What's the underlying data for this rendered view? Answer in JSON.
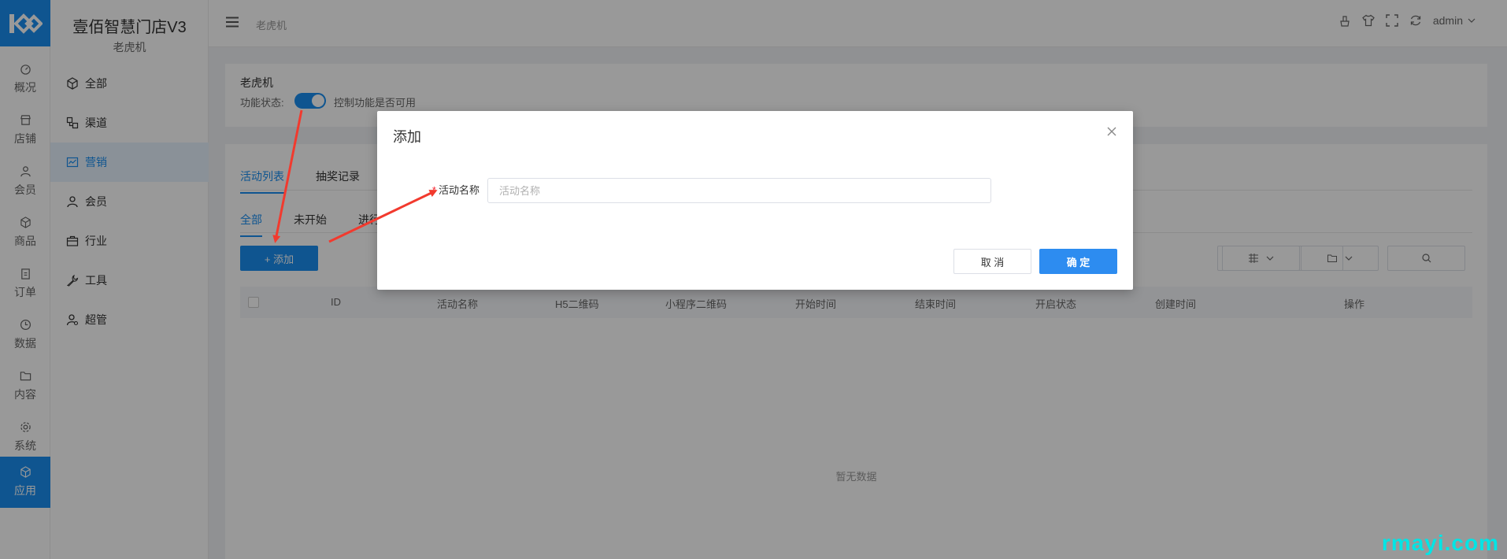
{
  "rail": {
    "items": [
      {
        "label": "概况",
        "icon": "dashboard-icon"
      },
      {
        "label": "店铺",
        "icon": "shop-icon"
      },
      {
        "label": "会员",
        "icon": "user-icon"
      },
      {
        "label": "商品",
        "icon": "cube-icon"
      },
      {
        "label": "订单",
        "icon": "clipboard-icon"
      },
      {
        "label": "数据",
        "icon": "clock-icon"
      },
      {
        "label": "内容",
        "icon": "folder-icon"
      },
      {
        "label": "系统",
        "icon": "gear-icon"
      },
      {
        "label": "应用",
        "icon": "app-icon",
        "active": true
      }
    ]
  },
  "sidebar": {
    "brand": "壹佰智慧门店V3",
    "subtitle": "老虎机",
    "items": [
      {
        "label": "全部",
        "icon": "cube-icon"
      },
      {
        "label": "渠道",
        "icon": "channel-icon"
      },
      {
        "label": "营销",
        "icon": "chart-icon",
        "active": true
      },
      {
        "label": "会员",
        "icon": "user-icon"
      },
      {
        "label": "行业",
        "icon": "briefcase-icon"
      },
      {
        "label": "工具",
        "icon": "wrench-icon"
      },
      {
        "label": "超管",
        "icon": "admin-icon"
      }
    ]
  },
  "header": {
    "breadcrumb": "老虎机",
    "user": "admin"
  },
  "feature": {
    "title": "老虎机",
    "status_label": "功能状态:",
    "status_hint": "控制功能是否可用",
    "enabled": true
  },
  "tabs": [
    "活动列表",
    "抽奖记录"
  ],
  "filter_tabs": [
    "全部",
    "未开始",
    "进行"
  ],
  "add_button": "+ 添加",
  "table": {
    "columns": [
      "ID",
      "活动名称",
      "H5二维码",
      "小程序二维码",
      "开始时间",
      "结束时间",
      "开启状态",
      "创建时间",
      "操作"
    ],
    "empty_text": "暂无数据"
  },
  "dialog": {
    "title": "添加",
    "field_label": "活动名称",
    "field_required_mark": "*",
    "field_placeholder": "活动名称",
    "cancel": "取 消",
    "ok": "确 定"
  },
  "watermark": "rmayi.com",
  "colors": {
    "accent": "#1a8ef0",
    "required": "#f5222d",
    "watermark": "#00e5e5",
    "arrow": "#f23a2e"
  }
}
